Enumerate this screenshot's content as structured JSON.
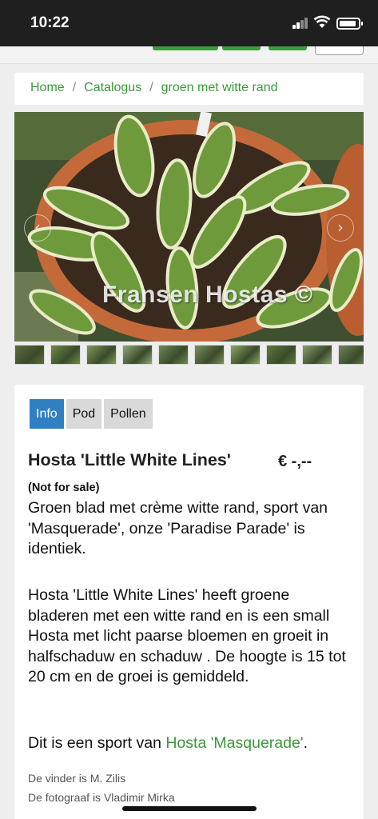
{
  "status_bar": {
    "time": "10:22"
  },
  "breadcrumb": {
    "items": [
      "Home",
      "Catalogus",
      "groen met witte rand"
    ]
  },
  "gallery": {
    "watermark": "Fransen Hostas ©",
    "prev_arrow": "‹",
    "next_arrow": "›",
    "thumb_colors": [
      "#5d6b3e",
      "#6e8a4a",
      "#7d9a5c",
      "#8fa87a",
      "#6b8a52",
      "#7a9160",
      "#8aa766",
      "#5e7a3e",
      "#88a070",
      "#6d8457"
    ]
  },
  "tabs": [
    {
      "label": "Info",
      "active": true
    },
    {
      "label": "Pod",
      "active": false
    },
    {
      "label": "Pollen",
      "active": false
    }
  ],
  "product": {
    "title": "Hosta 'Little White Lines'",
    "price": "€ -,--",
    "availability": "(Not for sale)",
    "description_1": "Groen blad met crème witte rand, sport van 'Masquerade', onze 'Paradise Parade' is identiek.",
    "description_2": "Hosta 'Little White Lines' heeft groene bladeren met een witte rand en is een small Hosta met licht paarse bloemen en groeit in halfschaduw en schaduw . De hoogte is 15 tot 20 cm en de groei is gemiddeld.",
    "sport_prefix": "Dit is een sport van ",
    "sport_link": "Hosta 'Masquerade'",
    "sport_suffix": ".",
    "finder": "De vinder is M. Zilis",
    "photographer": "De fotograaf is Vladimir Mirka"
  },
  "colors": {
    "accent_green": "#3a9a3a",
    "tab_active": "#2f7fc1"
  }
}
